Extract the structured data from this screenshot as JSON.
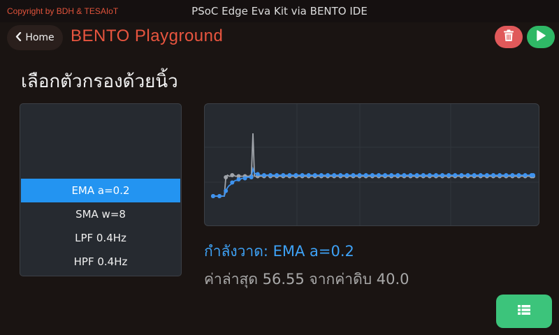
{
  "header": {
    "copyright": "Copyright by BDH & TESAIoT",
    "device_title": "PSoC Edge Eva Kit via BENTO IDE"
  },
  "nav": {
    "home_label": "Home",
    "app_title": "BENTO Playground"
  },
  "colors": {
    "accent_red": "#e8553f",
    "selected_blue": "#2394f1",
    "delete_button": "#e0595a",
    "run_button": "#2fb866",
    "filtered_series": "#3e93f0",
    "raw_series": "#a0a4aa"
  },
  "icons": {
    "back": "chevron-left-icon",
    "delete": "trash-icon",
    "run": "play-icon",
    "menu": "list-icon"
  },
  "main": {
    "heading": "เลือกตัวกรองด้วยนิ้ว",
    "filters": [
      "EMA a=0.2",
      "SMA w=8",
      "LPF 0.4Hz",
      "HPF 0.4Hz"
    ],
    "selected_index": 0,
    "now_drawing": "กำลังวาด: EMA a=0.2",
    "latest": "ค่าล่าสุด 56.55 จากค่าดิบ 40.0"
  },
  "chart_data": {
    "type": "line",
    "grid": true,
    "ylim": [
      20,
      120
    ],
    "series": [
      {
        "key": "raw",
        "values": [
          40,
          40,
          40,
          40,
          40,
          40,
          40,
          40,
          58,
          60,
          59,
          59,
          60,
          60,
          59,
          59,
          59,
          59,
          59,
          59,
          59,
          59,
          59,
          59,
          59,
          100,
          59,
          59,
          59,
          59,
          59,
          59,
          59,
          59,
          60,
          59,
          59,
          59,
          59,
          59,
          59,
          59,
          59,
          59,
          59,
          59,
          59,
          59,
          59,
          59,
          59,
          59,
          59,
          59,
          59,
          59,
          59,
          59,
          59,
          59,
          59,
          59,
          59,
          59,
          59,
          59,
          59,
          59,
          59,
          59,
          59,
          59,
          59,
          59,
          59,
          59,
          59,
          59,
          59,
          59,
          59,
          59,
          59,
          59,
          59,
          59,
          59,
          59,
          59,
          59,
          59,
          59,
          59,
          59,
          59,
          59,
          59,
          59,
          59,
          59,
          59,
          59,
          59,
          59,
          59,
          59,
          59,
          59,
          59,
          59,
          59,
          59,
          59,
          59,
          59,
          59,
          59,
          59,
          59,
          59,
          59,
          59,
          59,
          59,
          59,
          59,
          59,
          59,
          59,
          59,
          59,
          59,
          59,
          59,
          59,
          59,
          59,
          59,
          59,
          59,
          59,
          59,
          59,
          59,
          59,
          59,
          59,
          59,
          59,
          59,
          59,
          59,
          59,
          59,
          59,
          59,
          59,
          59,
          59,
          59,
          59,
          59,
          59,
          59,
          59,
          59,
          59,
          59,
          59,
          59,
          59,
          59,
          59,
          59,
          59,
          59,
          59,
          59,
          59,
          59,
          59,
          59,
          59,
          59,
          59,
          59,
          59,
          59,
          59,
          59,
          59,
          59,
          59,
          59,
          59,
          59,
          59,
          59,
          59,
          59,
          59,
          59
        ]
      },
      {
        "key": "ema",
        "values": [
          40,
          40,
          40,
          40,
          40,
          40,
          40,
          40,
          45,
          48,
          50,
          51,
          53,
          54,
          55,
          55,
          56,
          56,
          57,
          57,
          57,
          58,
          58,
          58,
          58,
          66,
          62,
          61,
          61,
          60,
          60,
          60,
          60,
          60,
          60,
          60,
          60,
          60,
          60,
          60,
          60,
          60,
          60,
          60,
          60,
          60,
          60,
          60,
          60,
          60,
          60,
          60,
          60,
          60,
          60,
          60,
          60,
          60,
          60,
          60,
          60,
          60,
          60,
          60,
          60,
          60,
          60,
          60,
          60,
          60,
          60,
          60,
          60,
          60,
          60,
          60,
          60,
          60,
          60,
          60,
          60,
          60,
          60,
          60,
          60,
          60,
          60,
          60,
          60,
          60,
          60,
          60,
          60,
          60,
          60,
          60,
          60,
          60,
          60,
          60,
          60,
          60,
          60,
          60,
          60,
          60,
          60,
          60,
          60,
          60,
          60,
          60,
          60,
          60,
          60,
          60,
          60,
          60,
          60,
          60,
          60,
          60,
          60,
          60,
          60,
          60,
          60,
          60,
          60,
          60,
          60,
          60,
          60,
          60,
          60,
          60,
          60,
          60,
          60,
          60,
          60,
          60,
          60,
          60,
          60,
          60,
          60,
          60,
          60,
          60,
          60,
          60,
          60,
          60,
          60,
          60,
          60,
          60,
          60,
          60,
          60,
          60,
          60,
          60,
          60,
          60,
          60,
          60,
          60,
          60,
          60,
          60,
          60,
          60,
          60,
          60,
          60,
          60,
          60,
          60,
          60,
          60,
          60,
          60,
          60,
          60,
          60,
          60,
          60,
          60,
          60,
          60,
          60,
          60,
          60,
          60,
          60,
          60,
          60,
          60,
          60,
          60
        ]
      }
    ]
  }
}
